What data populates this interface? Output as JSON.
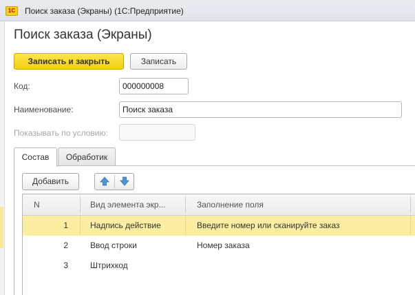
{
  "window": {
    "logo_text": "1С",
    "title": "Поиск заказа (Экраны)  (1С:Предприятие)"
  },
  "form": {
    "title": "Поиск заказа (Экраны)"
  },
  "toolbar": {
    "save_close_label": "Записать и закрыть",
    "save_label": "Записать"
  },
  "fields": {
    "code": {
      "label": "Код:",
      "value": "000000008"
    },
    "name": {
      "label": "Наименование:",
      "value": "Поиск заказа"
    },
    "condition": {
      "label": "Показывать по условию:",
      "value": ""
    }
  },
  "tabs": [
    {
      "label": "Состав",
      "active": true
    },
    {
      "label": "Обработик",
      "active": false
    }
  ],
  "table_toolbar": {
    "add_label": "Добавить",
    "up_icon": "arrow-up-icon",
    "down_icon": "arrow-down-icon"
  },
  "table": {
    "columns": [
      "N",
      "Вид элемента экр...",
      "Заполнение поля"
    ],
    "rows": [
      {
        "n": "1",
        "kind": "Надпись действие",
        "fill": "Введите номер или сканируйте заказ",
        "selected": true
      },
      {
        "n": "2",
        "kind": "Ввод строки",
        "fill": "Номер заказа",
        "selected": false
      },
      {
        "n": "3",
        "kind": "Штрихкод",
        "fill": "",
        "selected": false
      }
    ]
  },
  "colors": {
    "accent_yellow": "#f4cf14",
    "selected_row": "#fbeea1"
  }
}
